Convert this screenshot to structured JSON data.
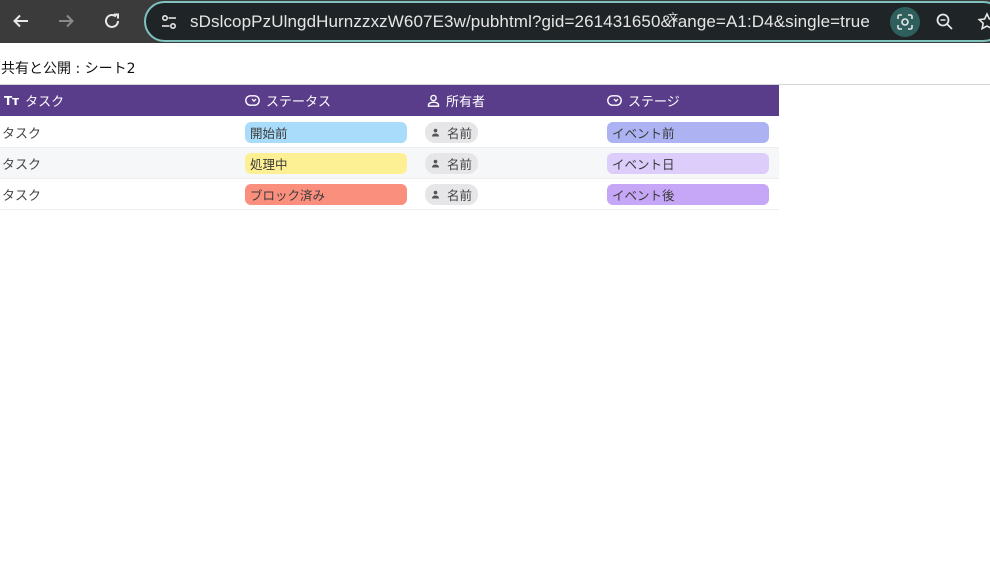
{
  "browser": {
    "url": "sDslcopPzUlngdHurnzzxzW607E3w/pubhtml?gid=261431650&range=A1:D4&single=true",
    "translate_glyph": "文"
  },
  "page": {
    "title": "共有と公開 : シート2"
  },
  "table": {
    "headers": {
      "task": "タスク",
      "status": "ステータス",
      "owner": "所有者",
      "stage": "ステージ"
    },
    "header_task_icon": "Tт",
    "rows": [
      {
        "task": "タスク",
        "status": "開始前",
        "status_color": "#a8dcfa",
        "owner": "名前",
        "stage": "イベント前",
        "stage_color": "#adb2f3"
      },
      {
        "task": "タスク",
        "status": "処理中",
        "status_color": "#fdf094",
        "owner": "名前",
        "stage": "イベント日",
        "stage_color": "#dccdfb"
      },
      {
        "task": "タスク",
        "status": "ブロック済み",
        "status_color": "#fb8f7e",
        "owner": "名前",
        "stage": "イベント後",
        "stage_color": "#c6a6f7"
      }
    ]
  },
  "colors": {
    "header_bg": "#5a3d8a",
    "toolbar_bg": "#3b3b3b",
    "omnibox_border": "#7fc3bf"
  }
}
